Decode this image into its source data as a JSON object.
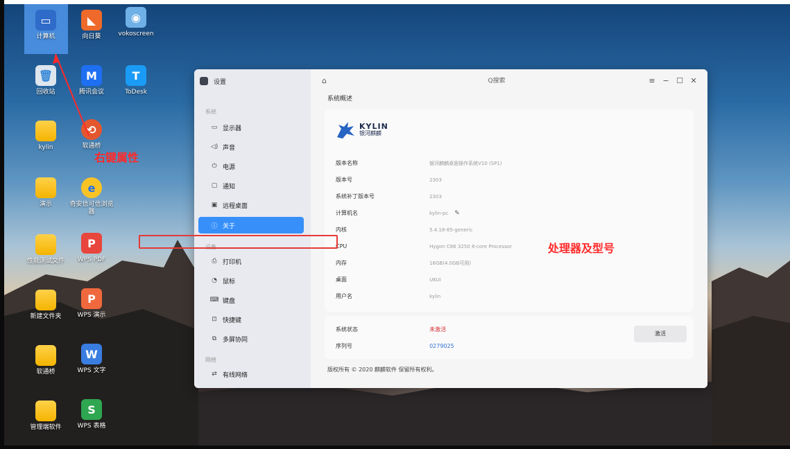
{
  "desktop": {
    "icons": [
      {
        "label": "计算机",
        "icon": "computer-icon"
      },
      {
        "label": "向日葵",
        "icon": "sunflower-icon"
      },
      {
        "label": "vokoscreen",
        "icon": "vokoscreen-icon"
      },
      {
        "label": "回收站",
        "icon": "trash-icon"
      },
      {
        "label": "腾讯会议",
        "icon": "tencent-meeting-icon"
      },
      {
        "label": "ToDesk",
        "icon": "todesk-icon"
      },
      {
        "label": "kylin",
        "icon": "folder-icon"
      },
      {
        "label": "软通桥",
        "icon": "softbridge-icon"
      },
      {
        "label": "演示",
        "icon": "folder-icon"
      },
      {
        "label": "奇安信可信浏览器",
        "icon": "browser-icon"
      },
      {
        "label": "性能测试文件",
        "icon": "folder-icon"
      },
      {
        "label": "WPS PDF",
        "icon": "wps-pdf-icon"
      },
      {
        "label": "新建文件夹",
        "icon": "folder-icon"
      },
      {
        "label": "WPS 演示",
        "icon": "wps-presentation-icon"
      },
      {
        "label": "软通桥",
        "icon": "folder-icon"
      },
      {
        "label": "WPS 文字",
        "icon": "wps-writer-icon"
      },
      {
        "label": "管理端软件",
        "icon": "folder-icon"
      },
      {
        "label": "WPS 表格",
        "icon": "wps-spreadsheet-icon"
      }
    ]
  },
  "annotations": {
    "right_click": "右键属性",
    "cpu_note": "处理器及型号",
    "color": "#ff2a2a"
  },
  "window": {
    "title": "设置",
    "search_placeholder": "Q搜索",
    "controls": [
      "≡",
      "−",
      "☐",
      "✕"
    ]
  },
  "sidebar": {
    "groups": [
      {
        "label": "系统",
        "items": [
          {
            "label": "显示器",
            "icon": "monitor-icon"
          },
          {
            "label": "声音",
            "icon": "speaker-icon"
          },
          {
            "label": "电源",
            "icon": "power-icon"
          },
          {
            "label": "通知",
            "icon": "notification-icon"
          },
          {
            "label": "远程桌面",
            "icon": "remote-desktop-icon"
          },
          {
            "label": "关于",
            "icon": "info-icon",
            "active": true
          }
        ]
      },
      {
        "label": "设备",
        "items": [
          {
            "label": "打印机",
            "icon": "printer-icon"
          },
          {
            "label": "鼠标",
            "icon": "mouse-icon"
          },
          {
            "label": "键盘",
            "icon": "keyboard-icon"
          },
          {
            "label": "快捷键",
            "icon": "shortcut-icon"
          },
          {
            "label": "多屏协同",
            "icon": "multiscreen-icon"
          }
        ]
      },
      {
        "label": "网络",
        "items": [
          {
            "label": "有线网络",
            "icon": "wired-network-icon"
          }
        ]
      }
    ],
    "accent": "#3790fa"
  },
  "about": {
    "section_title": "系统概述",
    "logo_en": "KYLIN",
    "logo_cn": "银河麒麟",
    "rows": [
      {
        "key": "版本名称",
        "value": "银河麒麟桌面操作系统V10 (SP1)"
      },
      {
        "key": "版本号",
        "value": "2303"
      },
      {
        "key": "系统补丁版本号",
        "value": "2303"
      },
      {
        "key": "计算机名",
        "value": "kylin-pc"
      },
      {
        "key": "内核",
        "value": "5.4.18-85-generic"
      },
      {
        "key": "CPU",
        "value": "Hygon C86 3250  8-core Processor"
      },
      {
        "key": "内存",
        "value": "16GB(4.0GB可用)"
      },
      {
        "key": "桌面",
        "value": "UKUI"
      },
      {
        "key": "用户名",
        "value": "kylin"
      }
    ],
    "status_label": "系统状态",
    "status_value": "未激活",
    "serial_label": "序列号",
    "serial_value": "0279025",
    "activate_label": "激活",
    "copyright": "版权所有 © 2020 麒麟软件 保留所有权利。"
  }
}
